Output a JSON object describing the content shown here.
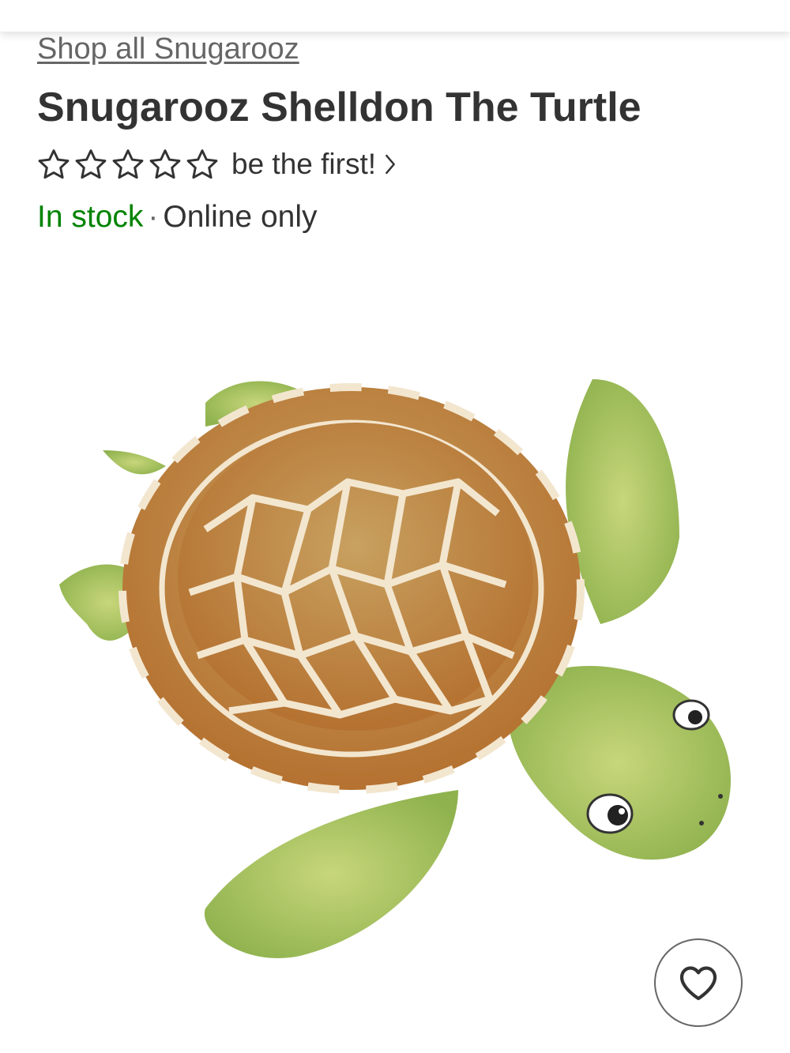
{
  "breadcrumb": {
    "shop_all_label": "Shop all Snugarooz"
  },
  "product": {
    "title": "Snugarooz Shelldon The Turtle",
    "image_alt": "Snugarooz Shelldon The Turtle plush toy"
  },
  "rating": {
    "stars_filled": 0,
    "stars_total": 5,
    "cta_label": "be the first!",
    "chevron_icon": "chevron-right-icon"
  },
  "availability": {
    "stock_status": "In stock",
    "separator": "·",
    "channel": "Online only",
    "stock_color": "#008300"
  },
  "actions": {
    "favorite_icon": "heart-icon"
  }
}
